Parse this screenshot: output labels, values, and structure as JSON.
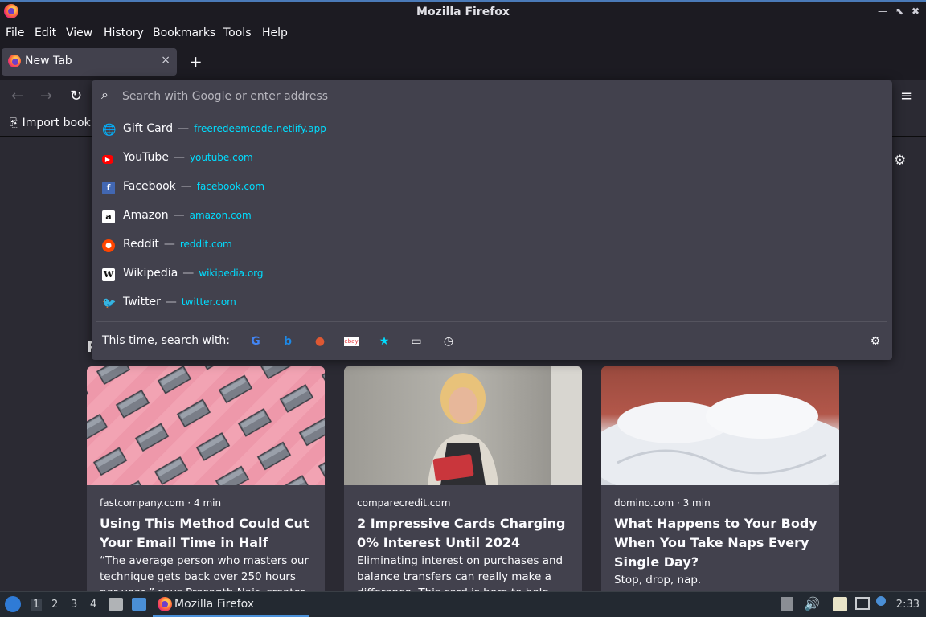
{
  "window": {
    "title": "Mozilla Firefox",
    "min": "—",
    "max": "⬉",
    "close": "✖"
  },
  "menu": [
    "File",
    "Edit",
    "View",
    "History",
    "Bookmarks",
    "Tools",
    "Help"
  ],
  "tab": {
    "label": "New Tab",
    "close": "×",
    "new": "+"
  },
  "bookmarks": {
    "import_label": "Import book"
  },
  "urlbar": {
    "placeholder": "Search with Google or enter address",
    "suggestions": [
      {
        "name": "Gift Card",
        "url": "freeredeemcode.netlify.app",
        "icon": "globe-icon"
      },
      {
        "name": "YouTube",
        "url": "youtube.com",
        "icon": "youtube-icon",
        "color": "#ff0000"
      },
      {
        "name": "Facebook",
        "url": "facebook.com",
        "icon": "facebook-icon",
        "color": "#4267b2"
      },
      {
        "name": "Amazon",
        "url": "amazon.com",
        "icon": "amazon-icon",
        "color": "#ffffff"
      },
      {
        "name": "Reddit",
        "url": "reddit.com",
        "icon": "reddit-icon",
        "color": "#ff4500"
      },
      {
        "name": "Wikipedia",
        "url": "wikipedia.org",
        "icon": "wikipedia-icon",
        "color": "#ffffff"
      },
      {
        "name": "Twitter",
        "url": "twitter.com",
        "icon": "twitter-icon",
        "color": "#1da1f2"
      }
    ],
    "separator": "—",
    "one_off_label": "This time, search with:"
  },
  "cards": [
    {
      "source": "fastcompany.com · 4 min",
      "title": "Using This Method Could Cut Your Email Time in Half",
      "excerpt": "“The average person who masters our technique gets back over 250 hours per year,” says Prasanth Nair, creator of the"
    },
    {
      "source": "comparecredit.com",
      "title": "2 Impressive Cards Charging 0% Interest Until 2024",
      "excerpt": "Eliminating interest on purchases and balance transfers can really make a difference. This card is here to help"
    },
    {
      "source": "domino.com · 3 min",
      "title": "What Happens to Your Body When You Take Naps Every Single Day?",
      "excerpt": "Stop, drop, nap."
    }
  ],
  "section_heading_initial": "P",
  "taskbar": {
    "workspaces": [
      "1",
      "2",
      "3",
      "4"
    ],
    "task_label": "Mozilla Firefox",
    "clock": "2:33"
  },
  "colors": {
    "accent": "#00ddff",
    "bg": "#2b2a33",
    "panel": "#42414d"
  }
}
